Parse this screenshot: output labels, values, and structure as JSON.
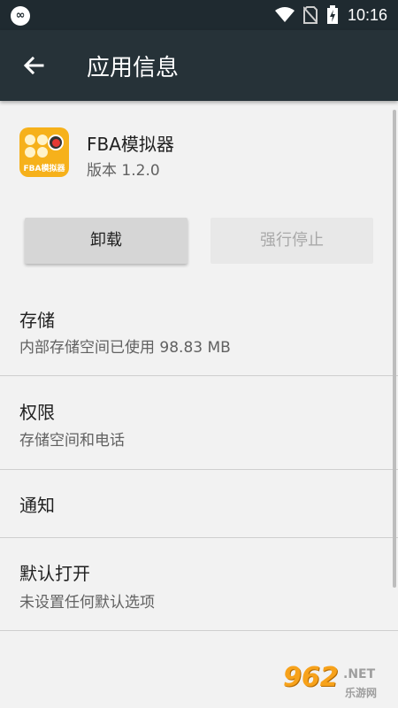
{
  "status_bar": {
    "time": "10:16"
  },
  "app_bar": {
    "title": "应用信息"
  },
  "app": {
    "name": "FBA模拟器",
    "version": "版本 1.2.0",
    "icon_label": "FBA模拟器"
  },
  "buttons": {
    "uninstall": "卸载",
    "force_stop": "强行停止"
  },
  "sections": [
    {
      "heading": "存储",
      "sub": "内部存储空间已使用 98.83 MB"
    },
    {
      "heading": "权限",
      "sub": "存储空间和电话"
    },
    {
      "heading": "通知"
    },
    {
      "heading": "默认打开",
      "sub": "未设置任何默认选项"
    }
  ],
  "watermark": {
    "num": "962",
    "net": ".NET",
    "cn": "乐游网"
  },
  "colors": {
    "status_bar": "#1f2a30",
    "app_bar": "#263238",
    "background": "#f2f2f2",
    "icon": "#f6b11b"
  }
}
